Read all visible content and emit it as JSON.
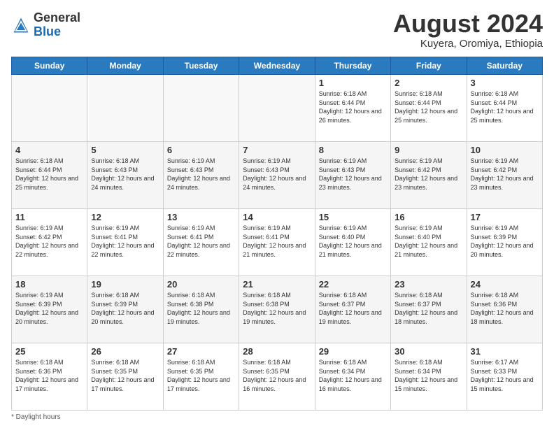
{
  "header": {
    "logo_general": "General",
    "logo_blue": "Blue",
    "month_year": "August 2024",
    "location": "Kuyera, Oromiya, Ethiopia"
  },
  "days_of_week": [
    "Sunday",
    "Monday",
    "Tuesday",
    "Wednesday",
    "Thursday",
    "Friday",
    "Saturday"
  ],
  "weeks": [
    [
      {
        "day": "",
        "info": ""
      },
      {
        "day": "",
        "info": ""
      },
      {
        "day": "",
        "info": ""
      },
      {
        "day": "",
        "info": ""
      },
      {
        "day": "1",
        "info": "Sunrise: 6:18 AM\nSunset: 6:44 PM\nDaylight: 12 hours\nand 26 minutes."
      },
      {
        "day": "2",
        "info": "Sunrise: 6:18 AM\nSunset: 6:44 PM\nDaylight: 12 hours\nand 25 minutes."
      },
      {
        "day": "3",
        "info": "Sunrise: 6:18 AM\nSunset: 6:44 PM\nDaylight: 12 hours\nand 25 minutes."
      }
    ],
    [
      {
        "day": "4",
        "info": "Sunrise: 6:18 AM\nSunset: 6:44 PM\nDaylight: 12 hours\nand 25 minutes."
      },
      {
        "day": "5",
        "info": "Sunrise: 6:18 AM\nSunset: 6:43 PM\nDaylight: 12 hours\nand 24 minutes."
      },
      {
        "day": "6",
        "info": "Sunrise: 6:19 AM\nSunset: 6:43 PM\nDaylight: 12 hours\nand 24 minutes."
      },
      {
        "day": "7",
        "info": "Sunrise: 6:19 AM\nSunset: 6:43 PM\nDaylight: 12 hours\nand 24 minutes."
      },
      {
        "day": "8",
        "info": "Sunrise: 6:19 AM\nSunset: 6:43 PM\nDaylight: 12 hours\nand 23 minutes."
      },
      {
        "day": "9",
        "info": "Sunrise: 6:19 AM\nSunset: 6:42 PM\nDaylight: 12 hours\nand 23 minutes."
      },
      {
        "day": "10",
        "info": "Sunrise: 6:19 AM\nSunset: 6:42 PM\nDaylight: 12 hours\nand 23 minutes."
      }
    ],
    [
      {
        "day": "11",
        "info": "Sunrise: 6:19 AM\nSunset: 6:42 PM\nDaylight: 12 hours\nand 22 minutes."
      },
      {
        "day": "12",
        "info": "Sunrise: 6:19 AM\nSunset: 6:41 PM\nDaylight: 12 hours\nand 22 minutes."
      },
      {
        "day": "13",
        "info": "Sunrise: 6:19 AM\nSunset: 6:41 PM\nDaylight: 12 hours\nand 22 minutes."
      },
      {
        "day": "14",
        "info": "Sunrise: 6:19 AM\nSunset: 6:41 PM\nDaylight: 12 hours\nand 21 minutes."
      },
      {
        "day": "15",
        "info": "Sunrise: 6:19 AM\nSunset: 6:40 PM\nDaylight: 12 hours\nand 21 minutes."
      },
      {
        "day": "16",
        "info": "Sunrise: 6:19 AM\nSunset: 6:40 PM\nDaylight: 12 hours\nand 21 minutes."
      },
      {
        "day": "17",
        "info": "Sunrise: 6:19 AM\nSunset: 6:39 PM\nDaylight: 12 hours\nand 20 minutes."
      }
    ],
    [
      {
        "day": "18",
        "info": "Sunrise: 6:19 AM\nSunset: 6:39 PM\nDaylight: 12 hours\nand 20 minutes."
      },
      {
        "day": "19",
        "info": "Sunrise: 6:18 AM\nSunset: 6:39 PM\nDaylight: 12 hours\nand 20 minutes."
      },
      {
        "day": "20",
        "info": "Sunrise: 6:18 AM\nSunset: 6:38 PM\nDaylight: 12 hours\nand 19 minutes."
      },
      {
        "day": "21",
        "info": "Sunrise: 6:18 AM\nSunset: 6:38 PM\nDaylight: 12 hours\nand 19 minutes."
      },
      {
        "day": "22",
        "info": "Sunrise: 6:18 AM\nSunset: 6:37 PM\nDaylight: 12 hours\nand 19 minutes."
      },
      {
        "day": "23",
        "info": "Sunrise: 6:18 AM\nSunset: 6:37 PM\nDaylight: 12 hours\nand 18 minutes."
      },
      {
        "day": "24",
        "info": "Sunrise: 6:18 AM\nSunset: 6:36 PM\nDaylight: 12 hours\nand 18 minutes."
      }
    ],
    [
      {
        "day": "25",
        "info": "Sunrise: 6:18 AM\nSunset: 6:36 PM\nDaylight: 12 hours\nand 17 minutes."
      },
      {
        "day": "26",
        "info": "Sunrise: 6:18 AM\nSunset: 6:35 PM\nDaylight: 12 hours\nand 17 minutes."
      },
      {
        "day": "27",
        "info": "Sunrise: 6:18 AM\nSunset: 6:35 PM\nDaylight: 12 hours\nand 17 minutes."
      },
      {
        "day": "28",
        "info": "Sunrise: 6:18 AM\nSunset: 6:35 PM\nDaylight: 12 hours\nand 16 minutes."
      },
      {
        "day": "29",
        "info": "Sunrise: 6:18 AM\nSunset: 6:34 PM\nDaylight: 12 hours\nand 16 minutes."
      },
      {
        "day": "30",
        "info": "Sunrise: 6:18 AM\nSunset: 6:34 PM\nDaylight: 12 hours\nand 15 minutes."
      },
      {
        "day": "31",
        "info": "Sunrise: 6:17 AM\nSunset: 6:33 PM\nDaylight: 12 hours\nand 15 minutes."
      }
    ]
  ],
  "footer": {
    "note": "Daylight hours"
  }
}
